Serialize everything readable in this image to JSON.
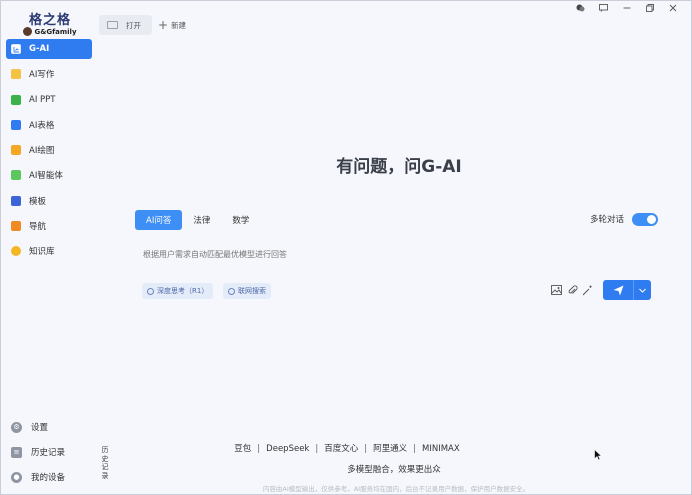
{
  "logo": {
    "cn": "格之格",
    "en": "G&Gfamily"
  },
  "sidebar": {
    "items": [
      {
        "label": "G-AI",
        "color": "#ffffff"
      },
      {
        "label": "AI写作",
        "color": "#f5c342"
      },
      {
        "label": "AI PPT",
        "color": "#3bb34a"
      },
      {
        "label": "AI表格",
        "color": "#2f7cf0"
      },
      {
        "label": "AI绘图",
        "color": "#f5a623"
      },
      {
        "label": "AI智能体",
        "color": "#5cc75f"
      },
      {
        "label": "模板",
        "color": "#3a64d8"
      },
      {
        "label": "导航",
        "color": "#f08a24"
      },
      {
        "label": "知识库",
        "color": "#f5b623"
      }
    ],
    "bottom": [
      {
        "label": "设置",
        "icon": "gear-icon"
      },
      {
        "label": "历史记录",
        "icon": "history-icon"
      },
      {
        "label": "我的设备",
        "icon": "device-icon"
      }
    ],
    "vertical_history": "历史记录"
  },
  "topbar": {
    "open_label": "打开",
    "new_label": "新建"
  },
  "window_controls": [
    "chat-icon",
    "message-icon",
    "minimize-icon",
    "maximize-icon",
    "close-icon"
  ],
  "main": {
    "headline": "有问题，问G-AI",
    "tabs": [
      {
        "label": "AI问答",
        "active": true
      },
      {
        "label": "法律",
        "active": false
      },
      {
        "label": "数学",
        "active": false
      }
    ],
    "multi_turn_label": "多轮对话",
    "multi_turn_on": true,
    "prompt_placeholder": "根据用户需求自动匹配最优模型进行回答",
    "chips": [
      {
        "label": "深度思考（R1）",
        "icon": "atom-icon"
      },
      {
        "label": "联网搜索",
        "icon": "search-icon"
      }
    ],
    "tools": [
      "image-icon",
      "attachment-icon",
      "magic-wand-icon"
    ]
  },
  "footer": {
    "models": [
      "豆包",
      "DeepSeek",
      "百度文心",
      "阿里通义",
      "MINIMAX"
    ],
    "separator": "|",
    "slogan": "多模型融合，效果更出众",
    "disclaimer": "内容由AI模型输出，仅供参考。AI服务均在国内，后台不记录用户数据，保护用户数据安全。"
  },
  "colors": {
    "accent": "#2f7cf0",
    "background": "#f5f7fc"
  }
}
